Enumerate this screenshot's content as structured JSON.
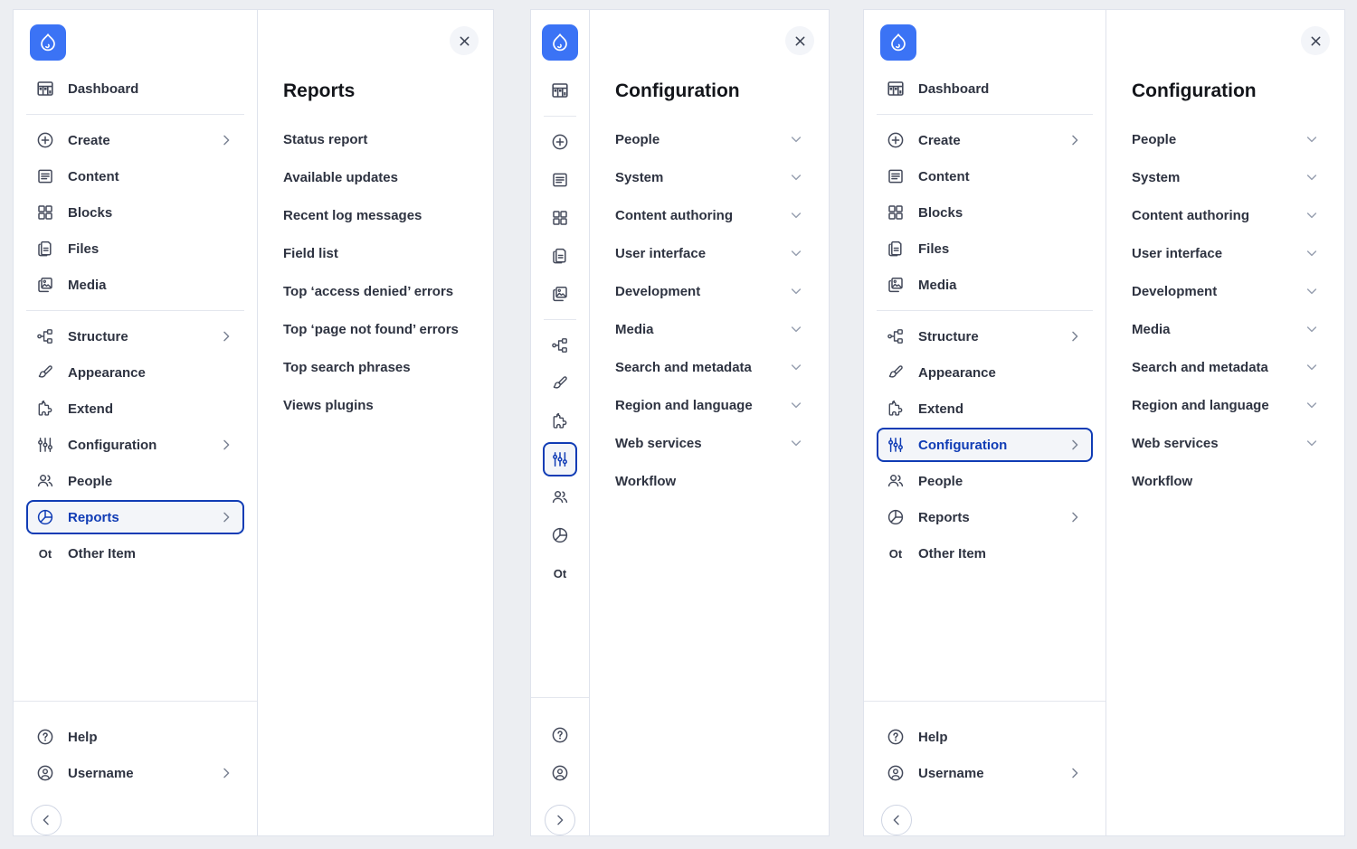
{
  "theme": {
    "page_background": "#eceef2",
    "panel_background": "#ffffff",
    "brand_blue": "#3b73f5",
    "active_border": "#103cb5",
    "active_background": "#f3f5f9",
    "text_color": "#2e3341",
    "muted_icon": "#98a0b1"
  },
  "logo": {
    "name": "drupal-logo"
  },
  "sidebar": {
    "top_items": [
      {
        "id": "dashboard",
        "icon": "dashboard-icon",
        "label": "Dashboard",
        "chevron": false
      }
    ],
    "main_items": [
      {
        "id": "create",
        "icon": "plus-circle-icon",
        "label": "Create",
        "chevron": true
      },
      {
        "id": "content",
        "icon": "content-icon",
        "label": "Content",
        "chevron": false
      },
      {
        "id": "blocks",
        "icon": "blocks-icon",
        "label": "Blocks",
        "chevron": false
      },
      {
        "id": "files",
        "icon": "files-icon",
        "label": "Files",
        "chevron": false
      },
      {
        "id": "media",
        "icon": "media-icon",
        "label": "Media",
        "chevron": false
      }
    ],
    "admin_items": [
      {
        "id": "structure",
        "icon": "structure-icon",
        "label": "Structure",
        "chevron": true
      },
      {
        "id": "appearance",
        "icon": "brush-icon",
        "label": "Appearance",
        "chevron": false
      },
      {
        "id": "extend",
        "icon": "puzzle-icon",
        "label": "Extend",
        "chevron": false
      },
      {
        "id": "configuration",
        "icon": "sliders-icon",
        "label": "Configuration",
        "chevron": true
      },
      {
        "id": "people",
        "icon": "people-icon",
        "label": "People",
        "chevron": false
      },
      {
        "id": "reports",
        "icon": "pie-chart-icon",
        "label": "Reports",
        "chevron": true
      },
      {
        "id": "other",
        "icon": "text-abbrev",
        "icon_text": "Ot",
        "label": "Other Item",
        "chevron": false
      }
    ],
    "footer_items": [
      {
        "id": "help",
        "icon": "help-circle-icon",
        "label": "Help",
        "chevron": false
      },
      {
        "id": "username",
        "icon": "user-circle-icon",
        "label": "Username",
        "chevron": true
      }
    ],
    "collapse_button": {
      "name": "collapse-sidebar-button",
      "icon": "chevron-left-icon"
    },
    "expand_button": {
      "name": "expand-sidebar-button",
      "icon": "chevron-right-icon"
    }
  },
  "variants": {
    "first_sidebar_active": "reports",
    "third_sidebar_active": "configuration",
    "rail_active": "configuration"
  },
  "flyouts": {
    "reports": {
      "title": "Reports",
      "close_icon": "close-icon",
      "items": [
        {
          "label": "Status report",
          "chevron": false
        },
        {
          "label": "Available updates",
          "chevron": false
        },
        {
          "label": "Recent log messages",
          "chevron": false
        },
        {
          "label": "Field list",
          "chevron": false
        },
        {
          "label": "Top ‘access denied’ errors",
          "chevron": false
        },
        {
          "label": "Top ‘page not found’ errors",
          "chevron": false
        },
        {
          "label": "Top search phrases",
          "chevron": false
        },
        {
          "label": "Views plugins",
          "chevron": false
        }
      ]
    },
    "configuration": {
      "title": "Configuration",
      "close_icon": "close-icon",
      "items": [
        {
          "label": "People",
          "chevron": true
        },
        {
          "label": "System",
          "chevron": true
        },
        {
          "label": "Content authoring",
          "chevron": true
        },
        {
          "label": "User interface",
          "chevron": true
        },
        {
          "label": "Development",
          "chevron": true
        },
        {
          "label": "Media",
          "chevron": true
        },
        {
          "label": "Search and metadata",
          "chevron": true
        },
        {
          "label": "Region and language",
          "chevron": true
        },
        {
          "label": "Web services",
          "chevron": true
        },
        {
          "label": "Workflow",
          "chevron": false
        }
      ]
    }
  }
}
